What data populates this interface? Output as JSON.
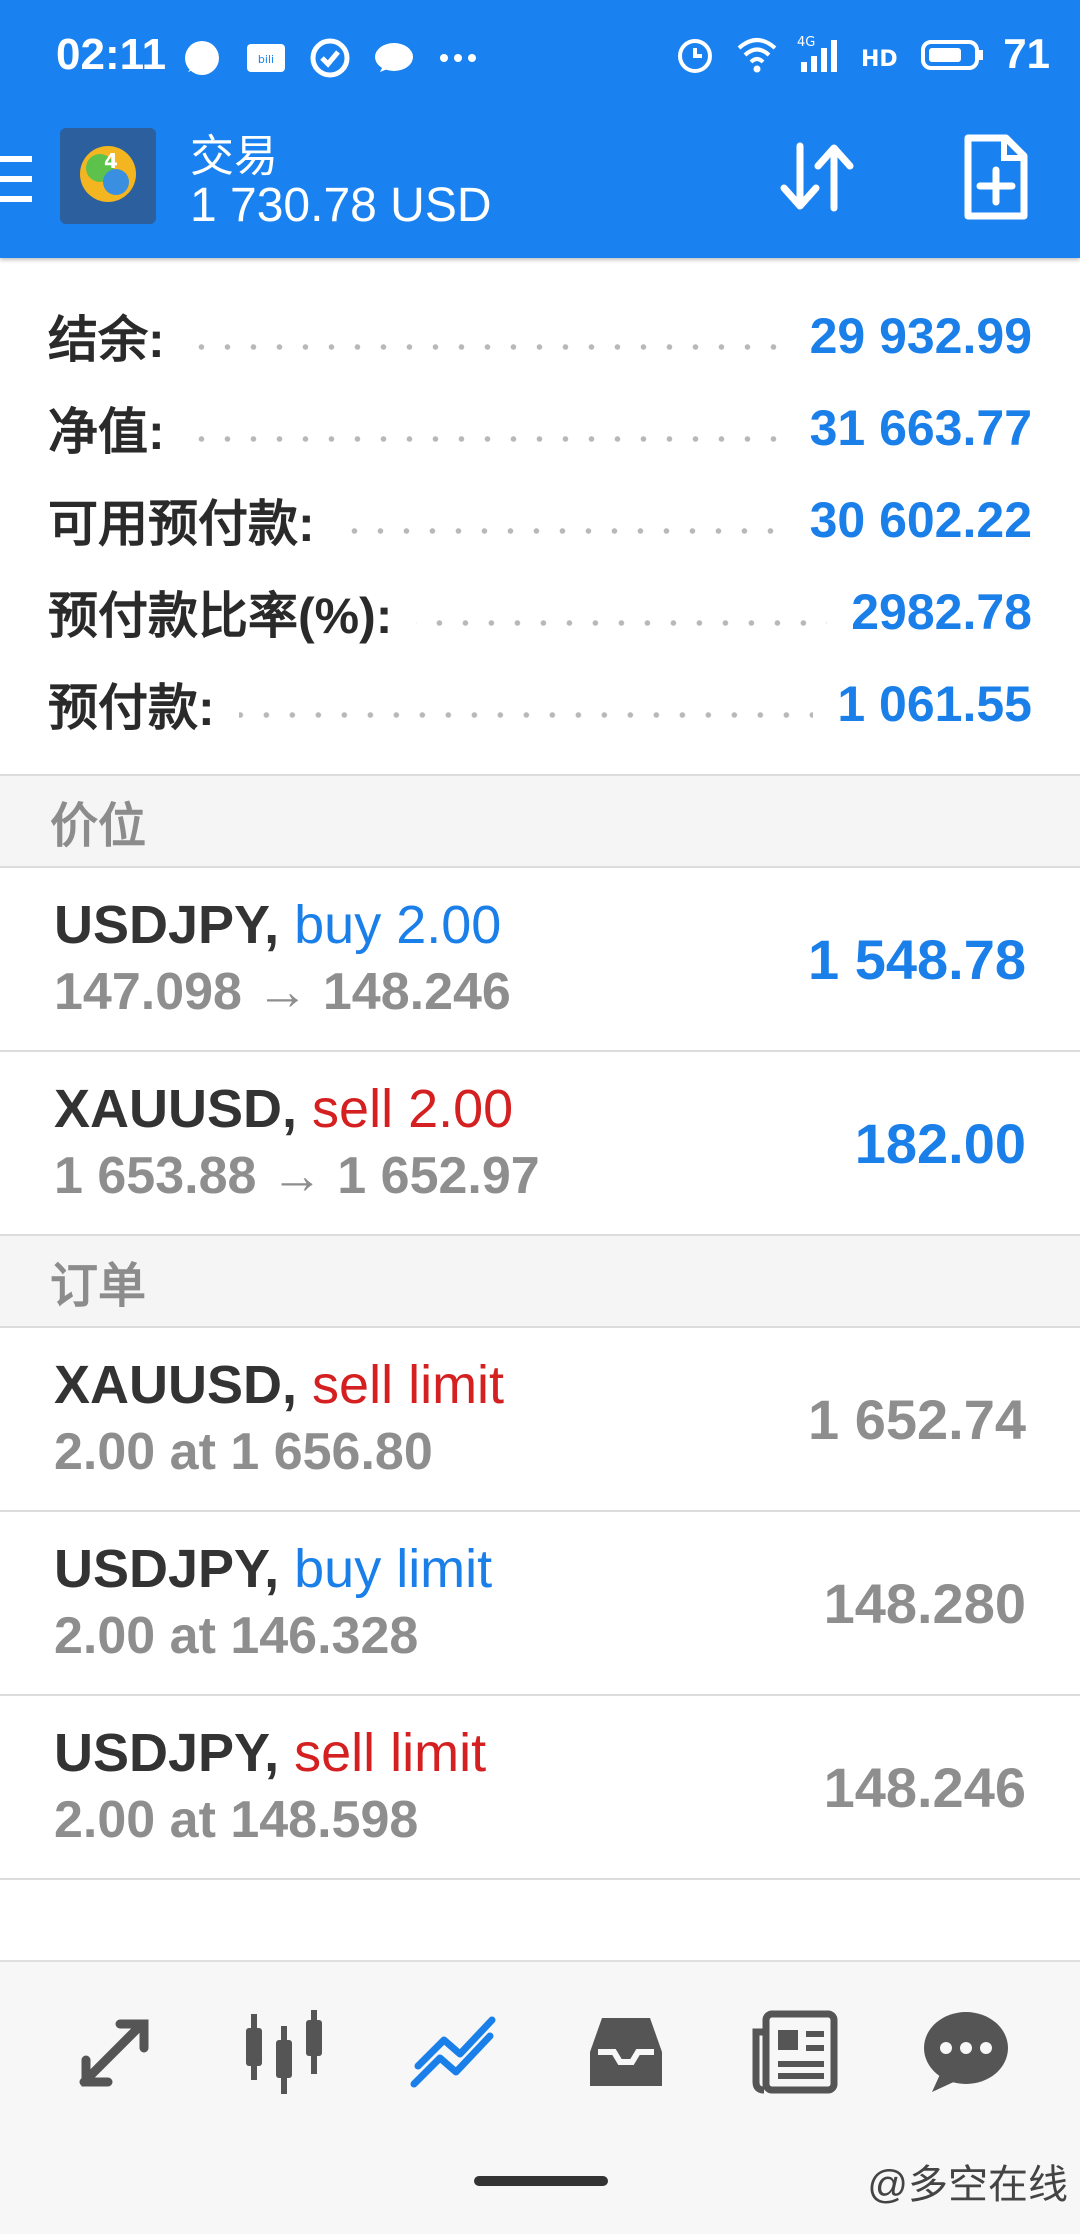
{
  "status_bar": {
    "time": "02:11",
    "network": "4G",
    "battery": "71"
  },
  "app_bar": {
    "title": "交易",
    "balance": "1 730.78 USD"
  },
  "summary": [
    {
      "label": "结余:",
      "value": "29 932.99"
    },
    {
      "label": "净值:",
      "value": "31 663.77"
    },
    {
      "label": "可用预付款:",
      "value": "30 602.22"
    },
    {
      "label": "预付款比率(%):",
      "value": "2982.78"
    },
    {
      "label": "预付款:",
      "value": "1 061.55"
    }
  ],
  "positions": {
    "header": "价位",
    "items": [
      {
        "symbol": "USDJPY,",
        "action": "buy 2.00",
        "side": "buy",
        "prices": "147.098 → 148.246",
        "value": "1 548.78"
      },
      {
        "symbol": "XAUUSD,",
        "action": "sell 2.00",
        "side": "sell",
        "prices": "1 653.88 → 1 652.97",
        "value": "182.00"
      }
    ]
  },
  "orders": {
    "header": "订单",
    "items": [
      {
        "symbol": "XAUUSD,",
        "action": "sell limit",
        "side": "sell",
        "detail": "2.00 at 1 656.80",
        "value": "1 652.74"
      },
      {
        "symbol": "USDJPY,",
        "action": "buy limit",
        "side": "buy",
        "detail": "2.00 at 146.328",
        "value": "148.280"
      },
      {
        "symbol": "USDJPY,",
        "action": "sell limit",
        "side": "sell",
        "detail": "2.00 at 148.598",
        "value": "148.246"
      }
    ]
  },
  "bottom_nav": {
    "items": [
      "quotes-icon",
      "chart-icon",
      "trade-icon",
      "history-icon",
      "news-icon",
      "chat-icon"
    ],
    "active": "trade-icon"
  },
  "watermark": "@多空在线",
  "colors": {
    "primary": "#1a82f0",
    "buy": "#1a7fe8",
    "sell": "#d42020",
    "muted": "#8e8e8e"
  }
}
